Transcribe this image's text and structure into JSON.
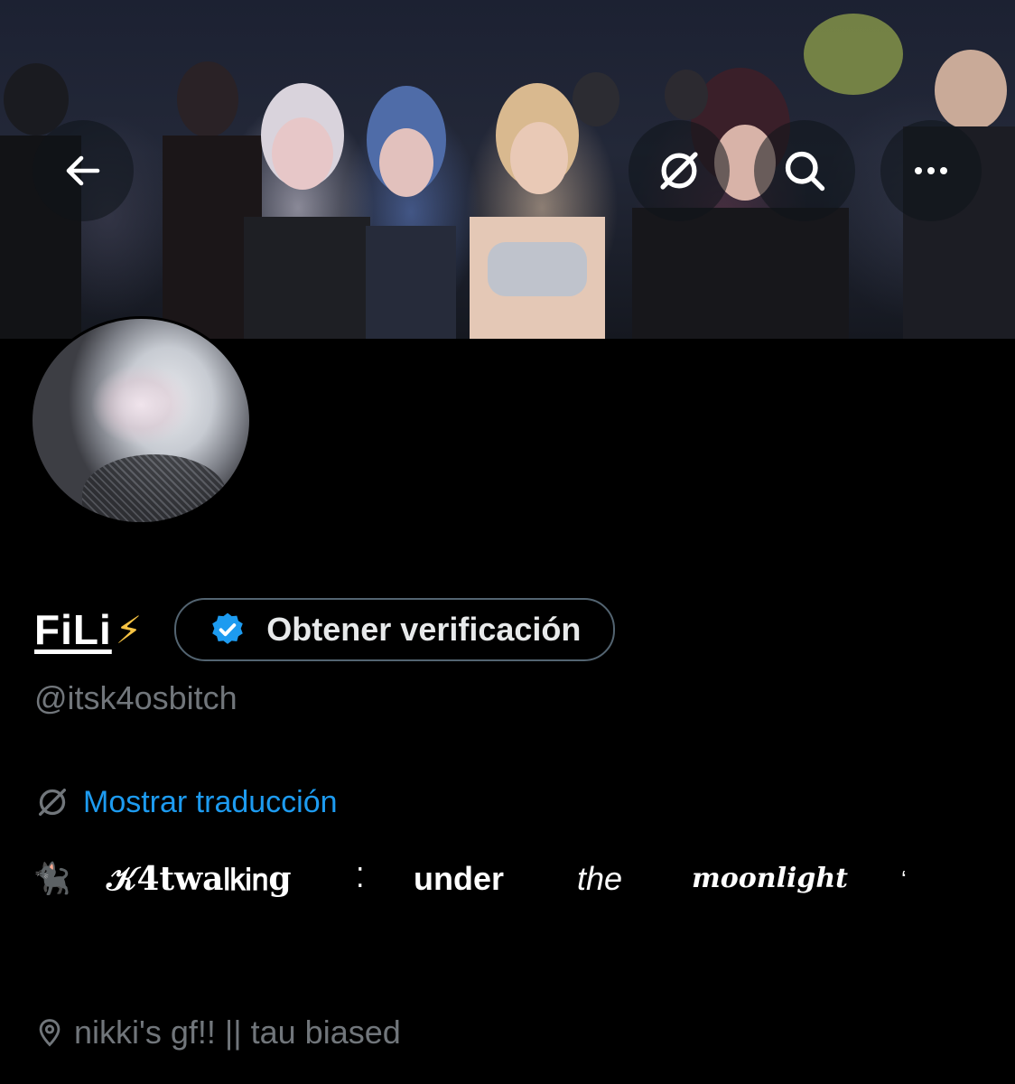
{
  "header": {
    "back_icon": "arrow-left-icon",
    "translate_icon": "translate-globe-icon",
    "search_icon": "search-icon",
    "more_icon": "more-dots-icon"
  },
  "profile": {
    "display_name": "FiLi",
    "name_emoji": "⚡",
    "verify_button_label": "Obtener verificación",
    "handle": "@itsk4osbitch",
    "translate_link": "Mostrar traducción",
    "bio": {
      "emoji": "🐈‍⬛",
      "word1": "𝒦4twa𝗅𝗄𝗂𝗇g",
      "separator1": "⁚",
      "word2": "under",
      "word3": "the",
      "word4": "moonlight",
      "separator2": "‘"
    },
    "location": "nikki's gf!! || tau biased"
  },
  "colors": {
    "background": "#000000",
    "text_primary": "#e7e9ea",
    "text_secondary": "#71767b",
    "link": "#1d9bf0",
    "verified_badge": "#1d9bf0",
    "border": "#536471"
  }
}
